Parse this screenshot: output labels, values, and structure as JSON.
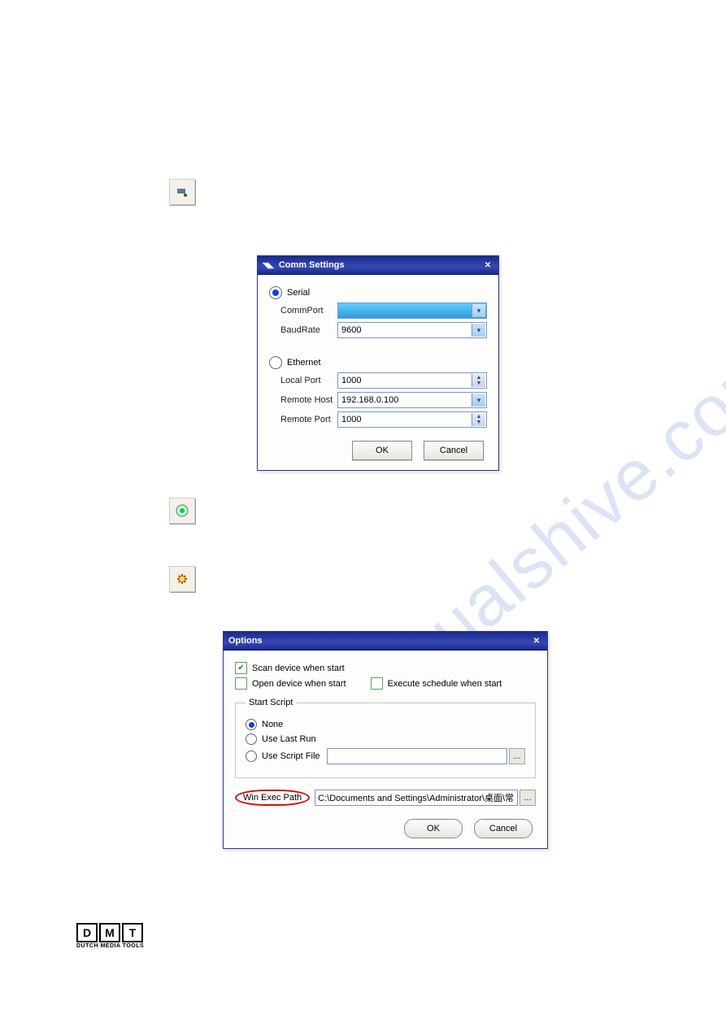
{
  "watermark": "manualshive.com",
  "icons": {
    "comm": "comm-port-icon",
    "connect": "connect-led-icon",
    "options": "options-gear-icon"
  },
  "comm": {
    "title": "Comm Settings",
    "sections": {
      "serial": {
        "radio_label": "Serial",
        "selected": true,
        "commport_label": "CommPort",
        "commport_value": "",
        "baud_label": "BaudRate",
        "baud_value": "9600"
      },
      "ethernet": {
        "radio_label": "Ethernet",
        "selected": false,
        "localport_label": "Local Port",
        "localport_value": "1000",
        "remotehost_label": "Remote Host",
        "remotehost_value": "192.168.0.100",
        "remoteport_label": "Remote Port",
        "remoteport_value": "1000"
      }
    },
    "ok": "OK",
    "cancel": "Cancel"
  },
  "options": {
    "title": "Options",
    "scan_label": "Scan device when start",
    "scan_checked": true,
    "open_label": "Open device when start",
    "open_checked": false,
    "exec_sched_label": "Execute schedule when start",
    "exec_sched_checked": false,
    "script_legend": "Start Script",
    "none_label": "None",
    "lastrun_label": "Use Last Run",
    "scriptfile_label": "Use Script File",
    "scriptfile_value": "",
    "winexec_label": "Win Exec Path",
    "winexec_value": "C:\\Documents and Settings\\Administrator\\桌面\\常",
    "ok": "OK",
    "cancel": "Cancel"
  },
  "logo": {
    "letters": [
      "D",
      "M",
      "T"
    ],
    "sub": "DUTCH MEDIA TOOLS"
  }
}
